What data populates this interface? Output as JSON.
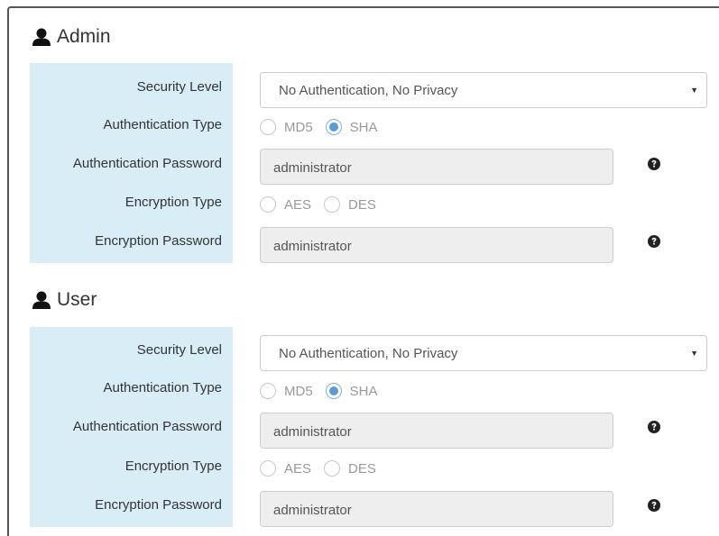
{
  "admin": {
    "title": "Admin",
    "icon": "user-icon",
    "labels": {
      "security_level": "Security Level",
      "authentication_type": "Authentication Type",
      "authentication_password": "Authentication Password",
      "encryption_type": "Encryption Type",
      "encryption_password": "Encryption Password"
    },
    "security_level_value": "No Authentication, No Privacy",
    "auth_options": [
      "MD5",
      "SHA"
    ],
    "auth_selected": "SHA",
    "enc_options": [
      "AES",
      "DES"
    ],
    "enc_selected": "",
    "auth_password": "administrator",
    "enc_password": "administrator"
  },
  "user": {
    "title": "User",
    "icon": "user-icon",
    "labels": {
      "security_level": "Security Level",
      "authentication_type": "Authentication Type",
      "authentication_password": "Authentication Password",
      "encryption_type": "Encryption Type",
      "encryption_password": "Encryption Password"
    },
    "security_level_value": "No Authentication, No Privacy",
    "auth_options": [
      "MD5",
      "SHA"
    ],
    "auth_selected": "SHA",
    "enc_options": [
      "AES",
      "DES"
    ],
    "enc_selected": "",
    "auth_password": "administrator",
    "enc_password": "administrator"
  },
  "colors": {
    "label_bg": "#d9edf7",
    "radio_checked": "#5b9bd5",
    "disabled_input_bg": "#eeeeee"
  },
  "icons": {
    "section": "user-icon",
    "help": "question-circle-icon",
    "dropdown": "caret-down-icon"
  }
}
